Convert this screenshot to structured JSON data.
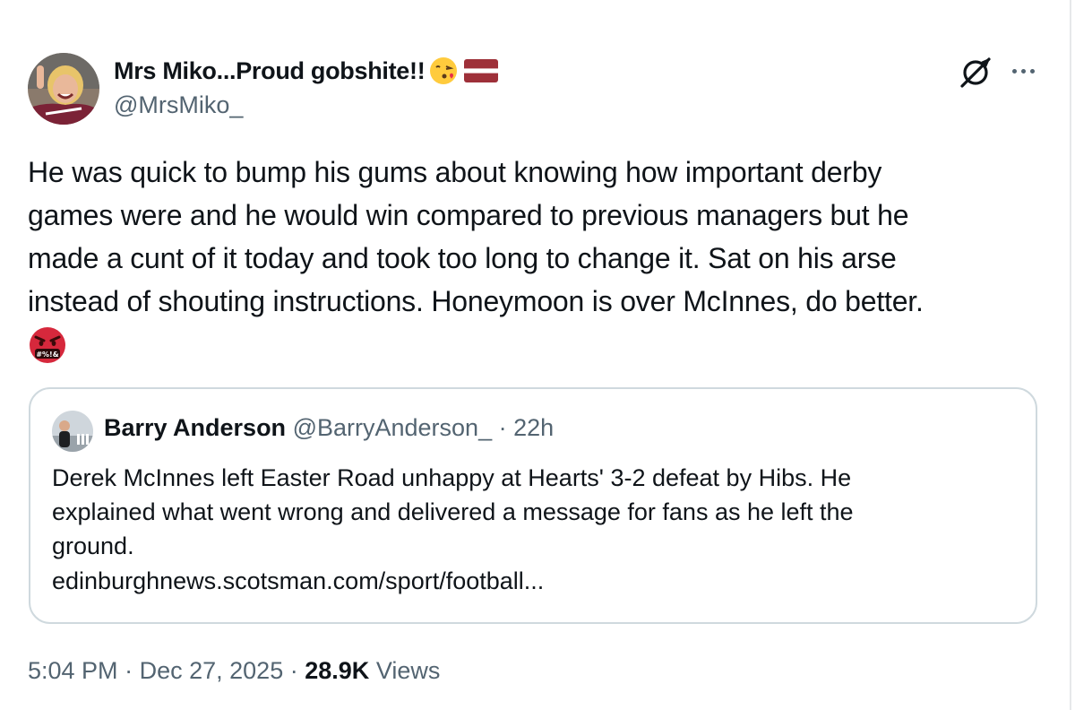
{
  "author": {
    "display_name": "Mrs Miko...Proud gobshite!!",
    "handle": "@MrsMiko_"
  },
  "icons": {
    "avatar": "avatar-photo",
    "emoji_1": "kissing-face-emoji",
    "emoji_2": "latvian-flag-emoji",
    "grok": "grok-icon",
    "more": "more-options-icon",
    "angry": "face-with-symbols-on-mouth-emoji"
  },
  "tweet": {
    "text": "He was quick to bump his gums about knowing how important derby\ngames were and he would win compared to previous managers but he\nmade a cunt of it today and took too long to change it. Sat on his arse\ninstead of shouting instructions. Honeymoon is over McInnes, do better."
  },
  "quote": {
    "name": "Barry Anderson",
    "handle": "@BarryAnderson_",
    "separator": "·",
    "time": "22h",
    "text": "Derek McInnes left Easter Road unhappy at Hearts' 3-2 defeat by Hibs. He\nexplained what went wrong and delivered a message for fans as he left the\nground.",
    "link": "edinburghnews.scotsman.com/sport/football..."
  },
  "meta": {
    "time": "5:04 PM",
    "separator": "·",
    "date": "Dec 27, 2025",
    "views_count": "28.9K",
    "views_label": "Views"
  },
  "colors": {
    "text_primary": "#0f1419",
    "text_secondary": "#536471",
    "border": "#cfd9de"
  }
}
